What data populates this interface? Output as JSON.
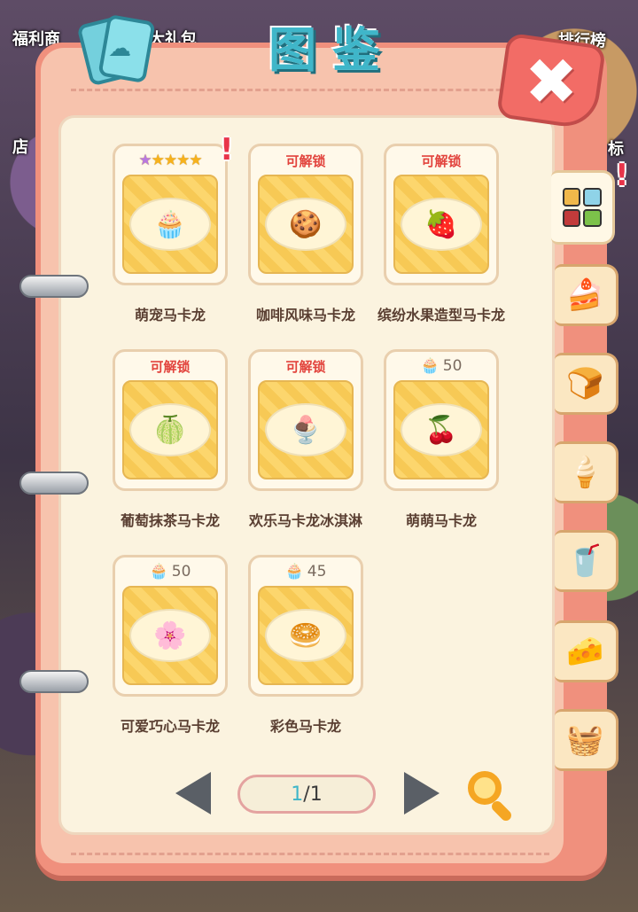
{
  "background": {
    "labels": [
      "福利商",
      "大礼包",
      "排行榜",
      "店",
      "标"
    ]
  },
  "title": "图鉴",
  "close_symbol": "✖",
  "collection": [
    {
      "name": "萌宠马卡龙",
      "status": "stars",
      "stars": 5,
      "alert": "!",
      "icon": "🧁"
    },
    {
      "name": "咖啡风味马卡龙",
      "status": "可解锁",
      "icon": "🍪"
    },
    {
      "name": "缤纷水果造型马卡龙",
      "status": "可解锁",
      "icon": "🍓"
    },
    {
      "name": "葡萄抹茶马卡龙",
      "status": "可解锁",
      "icon": "🍈"
    },
    {
      "name": "欢乐马卡龙冰淇淋",
      "status": "可解锁",
      "icon": "🍨"
    },
    {
      "name": "萌萌马卡龙",
      "status": "cost",
      "cost": "50",
      "icon": "🍒"
    },
    {
      "name": "可爱巧心马卡龙",
      "status": "cost",
      "cost": "50",
      "icon": "🌸"
    },
    {
      "name": "彩色马卡龙",
      "status": "cost",
      "cost": "45",
      "icon": "🥯"
    }
  ],
  "side_tabs": [
    {
      "name": "category-all",
      "icon": "grid",
      "active": true,
      "alert": "!"
    },
    {
      "name": "category-cake",
      "icon": "🍰"
    },
    {
      "name": "category-bread",
      "icon": "🍞"
    },
    {
      "name": "category-icecream",
      "icon": "🍦"
    },
    {
      "name": "category-drink",
      "icon": "🥤"
    },
    {
      "name": "category-cheese",
      "icon": "🧀"
    },
    {
      "name": "category-basket",
      "icon": "🧺"
    }
  ],
  "pagination": {
    "current": "1",
    "separator": "/",
    "total": "1"
  },
  "colors": {
    "accent": "#3fb6c9",
    "unlock_red": "#e2433c",
    "card_bg": "#fff9ea"
  }
}
